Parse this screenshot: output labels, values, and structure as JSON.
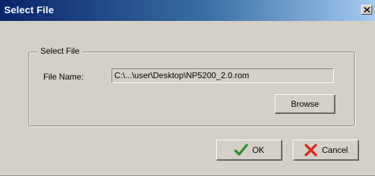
{
  "dialog": {
    "title": "Select File",
    "close_icon": "close-icon"
  },
  "group": {
    "legend": "Select File",
    "file_name_label": "File Name:",
    "file_name_value": "C:\\...\\user\\Desktop\\NP5200_2.0.rom",
    "browse_label": "Browse"
  },
  "buttons": {
    "ok_label": "OK",
    "ok_icon": "checkmark-icon",
    "cancel_label": "Cancel",
    "cancel_icon": "x-icon"
  },
  "colors": {
    "title_bar_start": "#0a246a",
    "title_bar_end": "#a6caf0",
    "face": "#d4d0c8",
    "check_green": "#2e8b2e",
    "cancel_red": "#d8281c"
  }
}
